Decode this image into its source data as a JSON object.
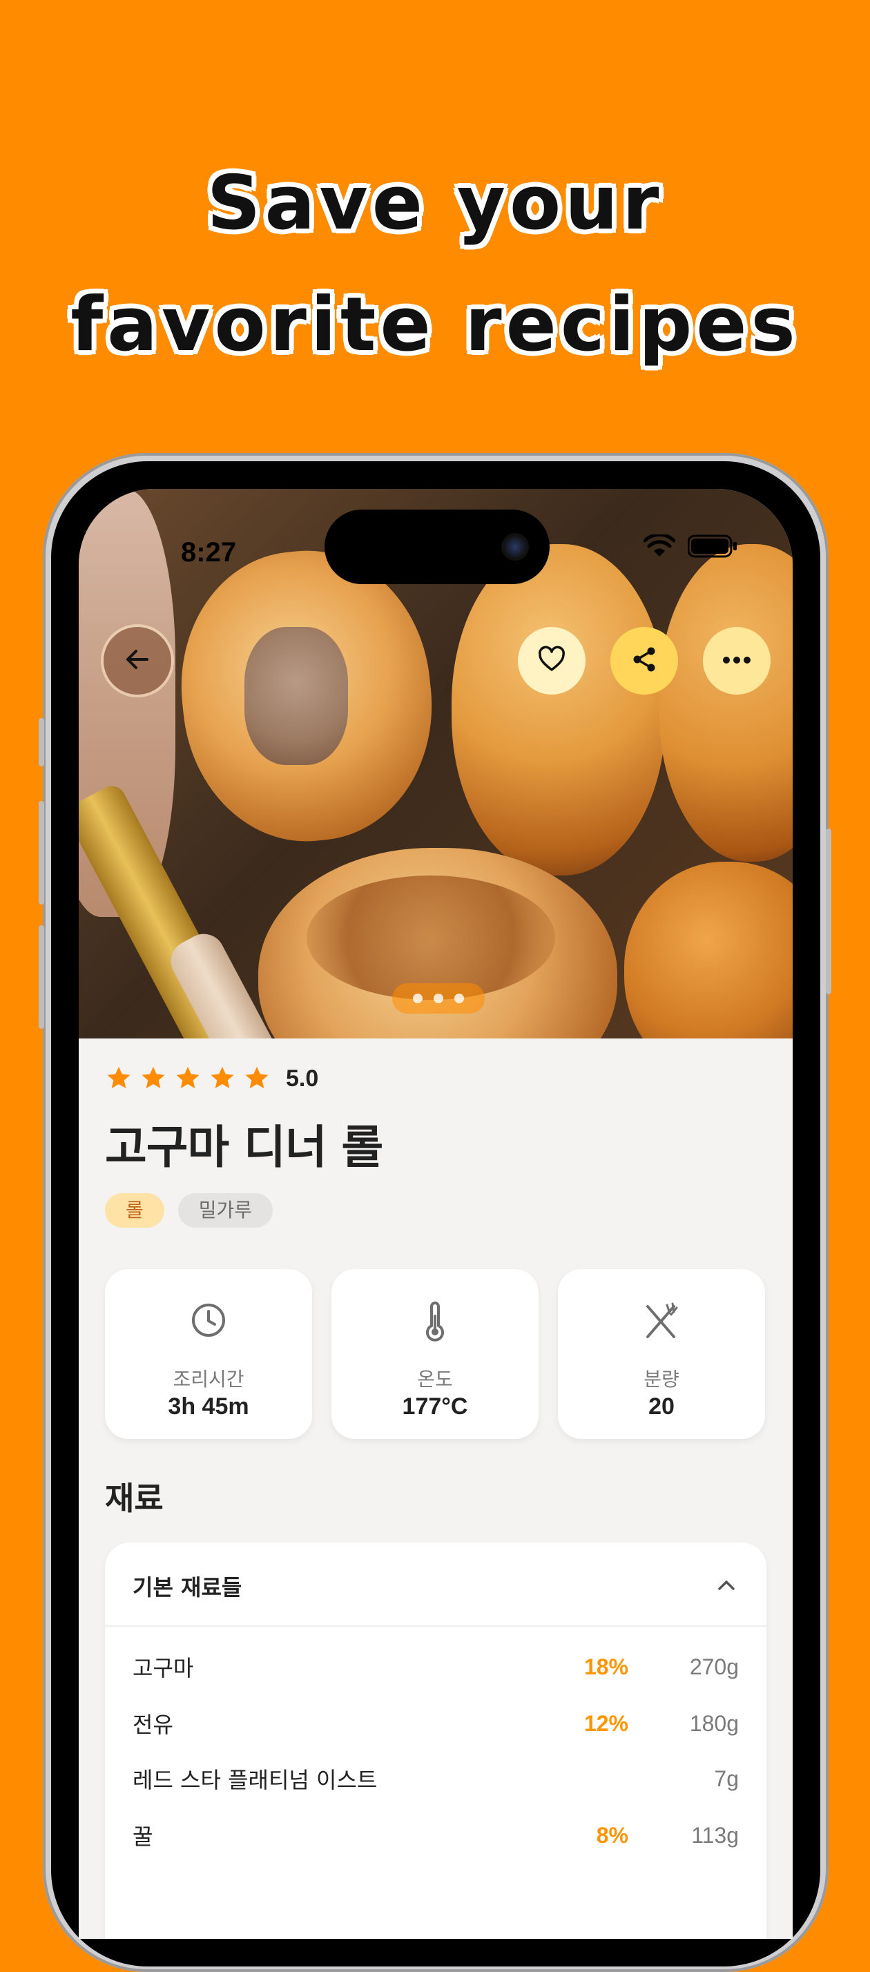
{
  "headline": {
    "line1": "Save your",
    "line2": "favorite recipes"
  },
  "status_bar": {
    "time": "8:27"
  },
  "hero": {
    "carousel_pages": 3,
    "active_page": 1
  },
  "recipe": {
    "rating_stars": 5,
    "rating_value": "5.0",
    "title": "고구마 디너 롤",
    "tags": [
      "롤",
      "밀가루"
    ]
  },
  "stats": [
    {
      "icon": "clock-icon",
      "label": "조리시간",
      "value": "3h 45m"
    },
    {
      "icon": "thermometer-icon",
      "label": "온도",
      "value": "177°C"
    },
    {
      "icon": "utensils-icon",
      "label": "분량",
      "value": "20"
    }
  ],
  "ingredients": {
    "section_title": "재료",
    "group_title": "기본 재료들",
    "items": [
      {
        "name": "고구마",
        "pct": "18%",
        "amount": "270g"
      },
      {
        "name": "전유",
        "pct": "12%",
        "amount": "180g"
      },
      {
        "name": "레드 스타 플래티넘 이스트",
        "pct": "",
        "amount": "7g"
      },
      {
        "name": "꿀",
        "pct": "8%",
        "amount": "113g"
      }
    ]
  },
  "colors": {
    "background": "#FF8C00",
    "accent": "#FF9500",
    "star": "#FF8C00"
  }
}
